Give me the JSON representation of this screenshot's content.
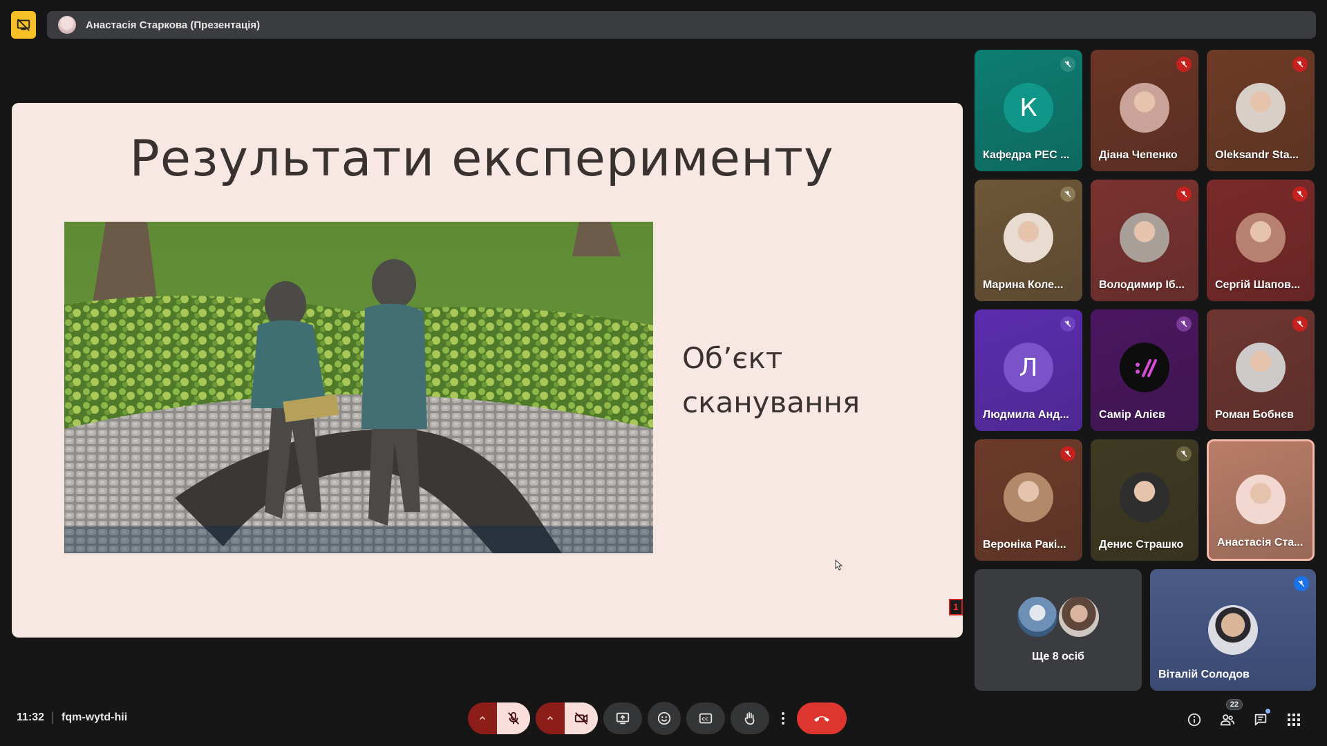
{
  "presenter": {
    "name": "Анастасія Старкова (Презентація)"
  },
  "slide": {
    "title": "Результати експерименту",
    "text_line1": "Об’єкт",
    "text_line2": "сканування",
    "marker": "1"
  },
  "participants": [
    {
      "name": "Кафедра РЕС ...",
      "letter": "К",
      "bg": "#0d7d72",
      "mic": "#2a8a7f",
      "type": "letter",
      "avatar_bg": "#11968a"
    },
    {
      "name": "Діана Чепенко",
      "bg": "#6b3526",
      "mic": "#c5221f",
      "type": "photo",
      "avatar_bg": "#c9a39a"
    },
    {
      "name": "Oleksandr Sta...",
      "bg": "#6e3b26",
      "mic": "#c5221f",
      "type": "photo",
      "avatar_bg": "#d8cfc9"
    },
    {
      "name": "Марина Коле...",
      "bg": "#6e5638",
      "mic": "#8a7a55",
      "type": "photo",
      "avatar_bg": "#e7dccf"
    },
    {
      "name": "Володимир Іб...",
      "bg": "#7a3330",
      "mic": "#c5221f",
      "type": "photo",
      "avatar_bg": "#a9a09a"
    },
    {
      "name": "Сергій Шапов...",
      "bg": "#7a2a29",
      "mic": "#c5221f",
      "type": "photo",
      "avatar_bg": "#b88070"
    },
    {
      "name": "Людмила Анд...",
      "letter": "Л",
      "bg": "#5c2db0",
      "mic": "#6f43bf",
      "type": "letter",
      "avatar_bg": "#7b52c7"
    },
    {
      "name": "Самір Алієв",
      "bg": "#4a1660",
      "mic": "#7a3b98",
      "type": "logo",
      "avatar_bg": "#0d0d0d"
    },
    {
      "name": "Роман Бобнєв",
      "bg": "#6e3530",
      "mic": "#c5221f",
      "type": "photo",
      "avatar_bg": "#cfcaca"
    },
    {
      "name": "Вероніка Ракі...",
      "bg": "#6d3b2a",
      "mic": "#c5221f",
      "type": "photo",
      "avatar_bg": "#b28a6a"
    },
    {
      "name": "Денис Страшко",
      "bg": "#3f3a22",
      "mic": "#6a6340",
      "type": "photo",
      "avatar_bg": "#2e2e2e"
    },
    {
      "name": "Анастасія Ста...",
      "bg": "#b97d68",
      "mic": "",
      "type": "photo",
      "avatar_bg": "#f2d8d0",
      "active": true
    }
  ],
  "more": {
    "label": "Ще 8 осіб"
  },
  "featured": {
    "name": "Віталій Солодов",
    "mic": "#1a73e8"
  },
  "meeting": {
    "time": "11:32",
    "code": "fqm-wytd-hii"
  },
  "people_count": "22",
  "colors": {
    "background": "#161616",
    "hangup": "#dc362e",
    "muted_bg": "#f9dedc",
    "muted_group": "#8c1d18",
    "slide_bg": "#f8e8e4"
  },
  "icons": {
    "stop": "stop-presenting-icon",
    "mic": "mic-off-icon",
    "cam": "camera-off-icon",
    "present": "present-screen-icon",
    "emoji": "emoji-icon",
    "cc": "captions-icon",
    "hand": "raise-hand-icon",
    "more": "more-options-icon",
    "hangup": "hang-up-icon",
    "info": "info-icon",
    "people": "people-icon",
    "chat": "chat-icon",
    "activities": "activities-icon"
  }
}
